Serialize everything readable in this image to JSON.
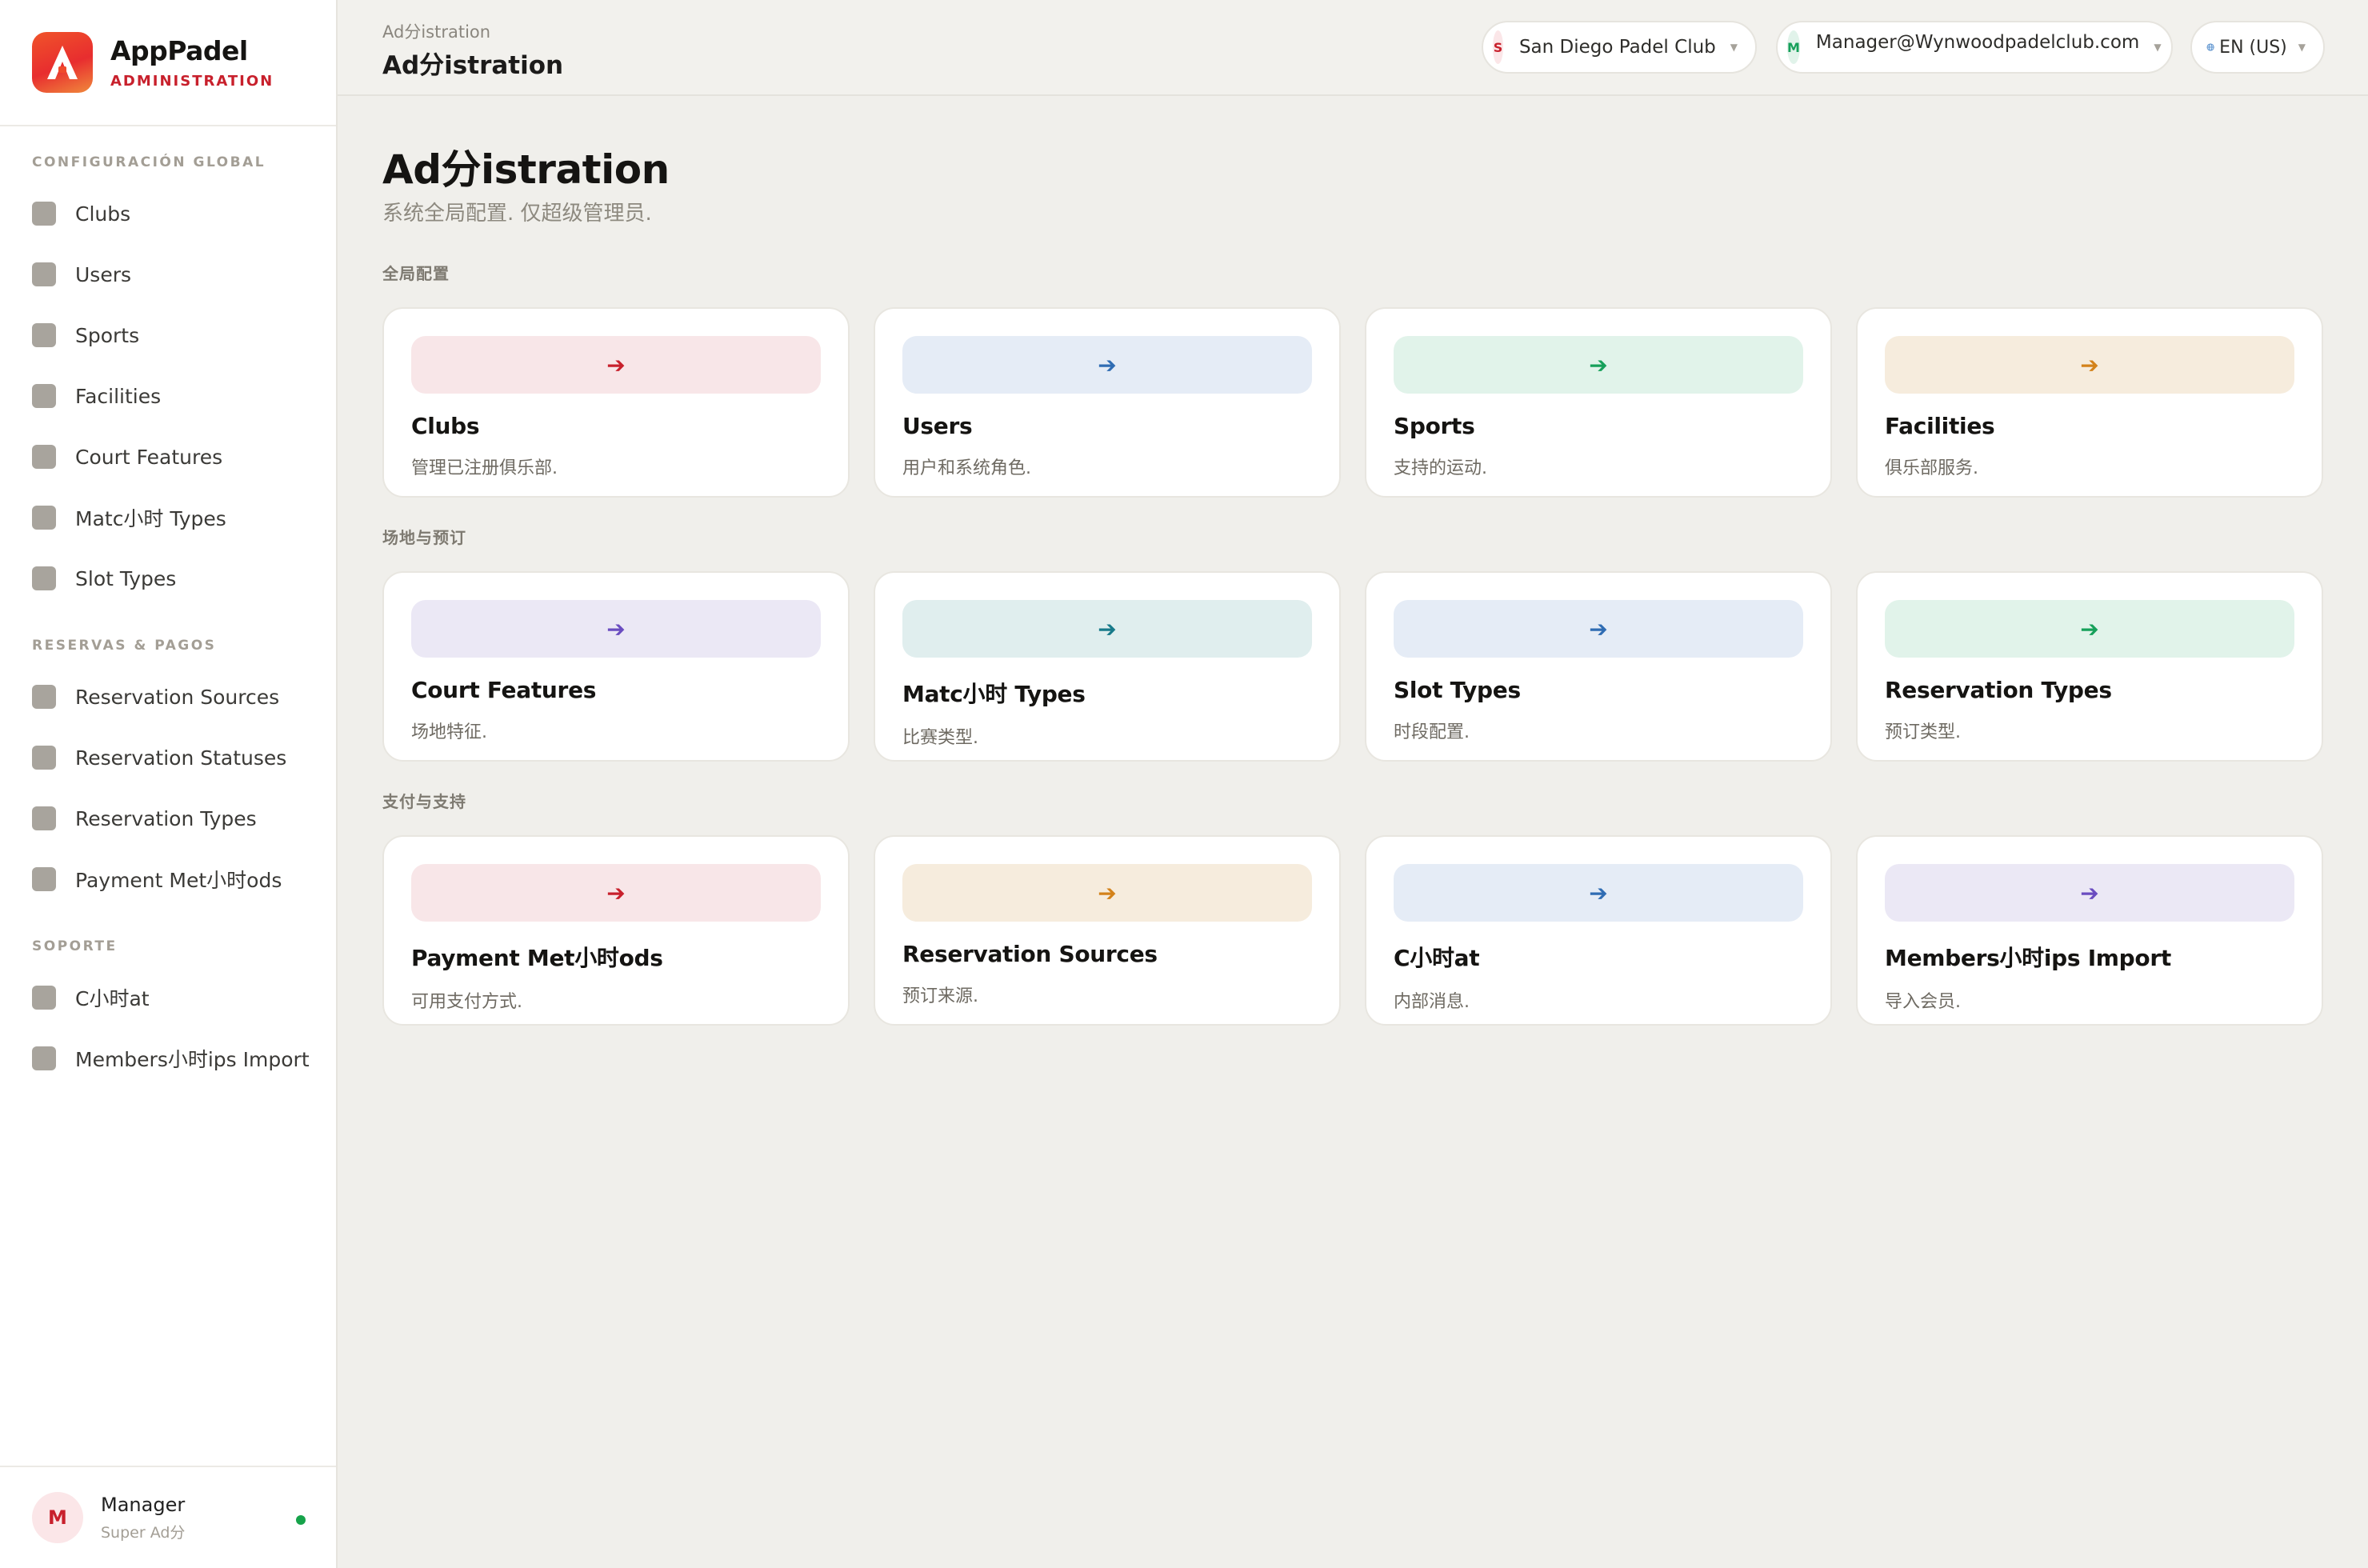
{
  "brand": {
    "name": "AppPadel",
    "subtitle": "ADMINISTRATION"
  },
  "sidebar": {
    "sections": [
      {
        "title": "CONFIGURACIÓN GLOBAL",
        "items": [
          "Clubs",
          "Users",
          "Sports",
          "Facilities",
          "Court Features",
          "Matc小时 Types",
          "Slot Types"
        ]
      },
      {
        "title": "RESERVAS & PAGOS",
        "items": [
          "Reservation Sources",
          "Reservation Statuses",
          "Reservation Types",
          "Payment Met小时ods"
        ]
      },
      {
        "title": "SOPORTE",
        "items": [
          "C小时at",
          "Members小时ips Import"
        ]
      }
    ],
    "user": {
      "initial": "M",
      "name": "Manager",
      "role": "Super Ad分"
    }
  },
  "topbar": {
    "breadcrumb": "Ad分istration",
    "title": "Ad分istration",
    "club": {
      "initial": "S",
      "label": "San Diego Padel Club"
    },
    "account": {
      "initial": "M",
      "label": "Manager@Wynwoodpadelclub.com"
    },
    "language": {
      "label": "EN (US)"
    }
  },
  "main": {
    "title": "Ad分istration",
    "subtitle": "系统全局配置. 仅超级管理员.",
    "sections": [
      {
        "title": "全局配置",
        "cards": [
          {
            "title": "Clubs",
            "desc": "管理已注册俱乐部.",
            "bg": "#f8e6e8",
            "fg": "#c8202c"
          },
          {
            "title": "Users",
            "desc": "用户和系统角色.",
            "bg": "#e5ecf6",
            "fg": "#2f6cb3"
          },
          {
            "title": "Sports",
            "desc": "支持的运动.",
            "bg": "#e1f3ea",
            "fg": "#16a05a"
          },
          {
            "title": "Facilities",
            "desc": "俱乐部服务.",
            "bg": "#f6ecdd",
            "fg": "#d3821a"
          }
        ]
      },
      {
        "title": "场地与预订",
        "cards": [
          {
            "title": "Court Features",
            "desc": "场地特征.",
            "bg": "#ebe8f5",
            "fg": "#6a4cc0"
          },
          {
            "title": "Matc小时 Types",
            "desc": "比赛类型.",
            "bg": "#e0eeee",
            "fg": "#187a8a"
          },
          {
            "title": "Slot Types",
            "desc": "时段配置.",
            "bg": "#e5ecf6",
            "fg": "#2f6cb3"
          },
          {
            "title": "Reservation Types",
            "desc": "预订类型.",
            "bg": "#e1f3ea",
            "fg": "#16a05a"
          }
        ]
      },
      {
        "title": "支付与支持",
        "cards": [
          {
            "title": "Payment Met小时ods",
            "desc": "可用支付方式.",
            "bg": "#f8e6e8",
            "fg": "#c8202c"
          },
          {
            "title": "Reservation Sources",
            "desc": "预订来源.",
            "bg": "#f6ecdd",
            "fg": "#d3821a"
          },
          {
            "title": "C小时at",
            "desc": "内部消息.",
            "bg": "#e5ecf6",
            "fg": "#2f6cb3"
          },
          {
            "title": "Members小时ips Import",
            "desc": "导入会员.",
            "bg": "#ebe8f5",
            "fg": "#6a4cc0"
          }
        ]
      }
    ]
  },
  "icons": {
    "card_action": "arrow-right-icon",
    "language": "globe-icon",
    "caret": "chevron-down-icon"
  }
}
